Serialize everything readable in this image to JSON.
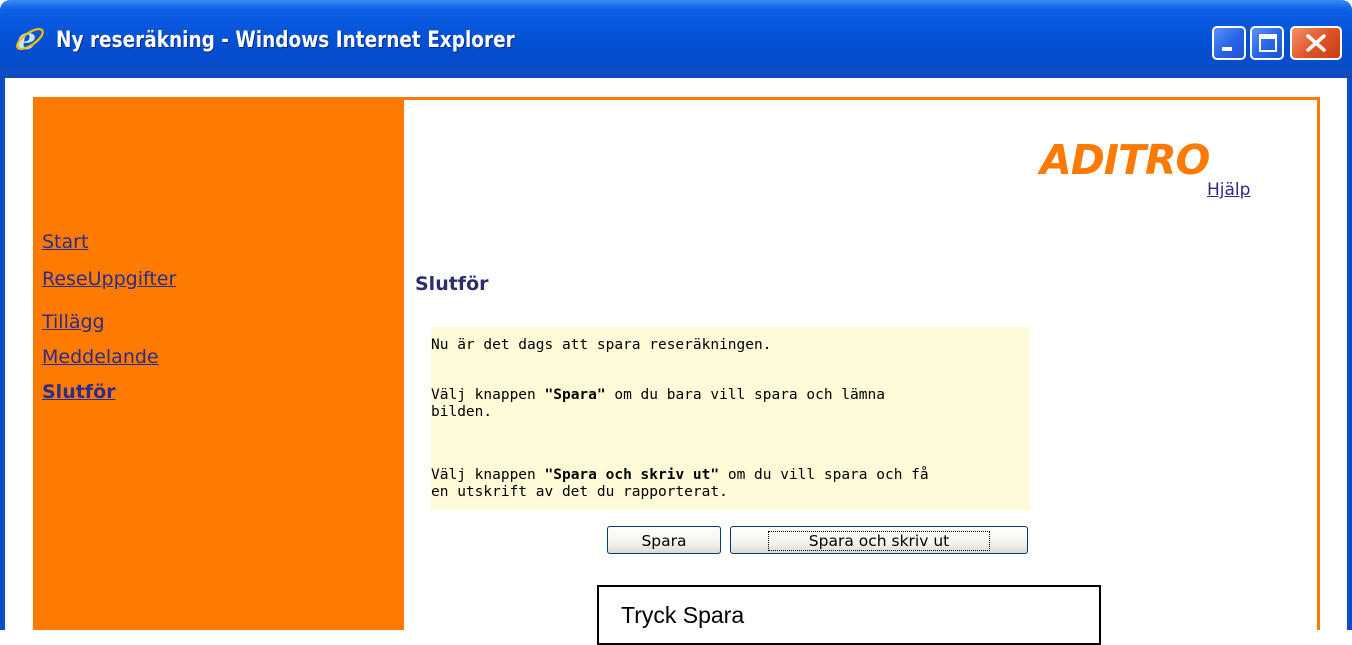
{
  "window": {
    "title": "Ny reseräkning - Windows Internet Explorer",
    "icon": "ie-icon",
    "controls": [
      "minimize-icon",
      "maximize-icon",
      "close-icon"
    ]
  },
  "header": {
    "logo": "ADITRO",
    "help_link": "Hjälp"
  },
  "sidebar": {
    "items": [
      {
        "label": "Start",
        "active": false
      },
      {
        "label": "ReseUppgifter",
        "active": false
      },
      {
        "label": "Tillägg",
        "active": false
      },
      {
        "label": "Meddelande",
        "active": false
      },
      {
        "label": "Slutför",
        "active": true
      }
    ]
  },
  "main": {
    "heading": "Slutför",
    "info": {
      "line1": "Nu är det dags att spara reseräkningen.",
      "p2_prefix": "Välj knappen ",
      "p2_bold": "\"Spara\"",
      "p2_mid": " om du bara vill spara och lämna",
      "p2_end": "bilden.",
      "p3_prefix": "Välj knappen ",
      "p3_bold": "\"Spara och skriv ut\"",
      "p3_mid": " om du vill spara och få",
      "p3_end": "en utskrift av det du rapporterat."
    },
    "buttons": {
      "save": "Spara",
      "save_print": "Spara och skriv ut"
    }
  },
  "callout": {
    "text": "Tryck Spara"
  },
  "colors": {
    "accent": "#ff7a00",
    "titlebar": "#0553d7",
    "link": "#2d2d86",
    "info_bg": "#fffad8"
  }
}
